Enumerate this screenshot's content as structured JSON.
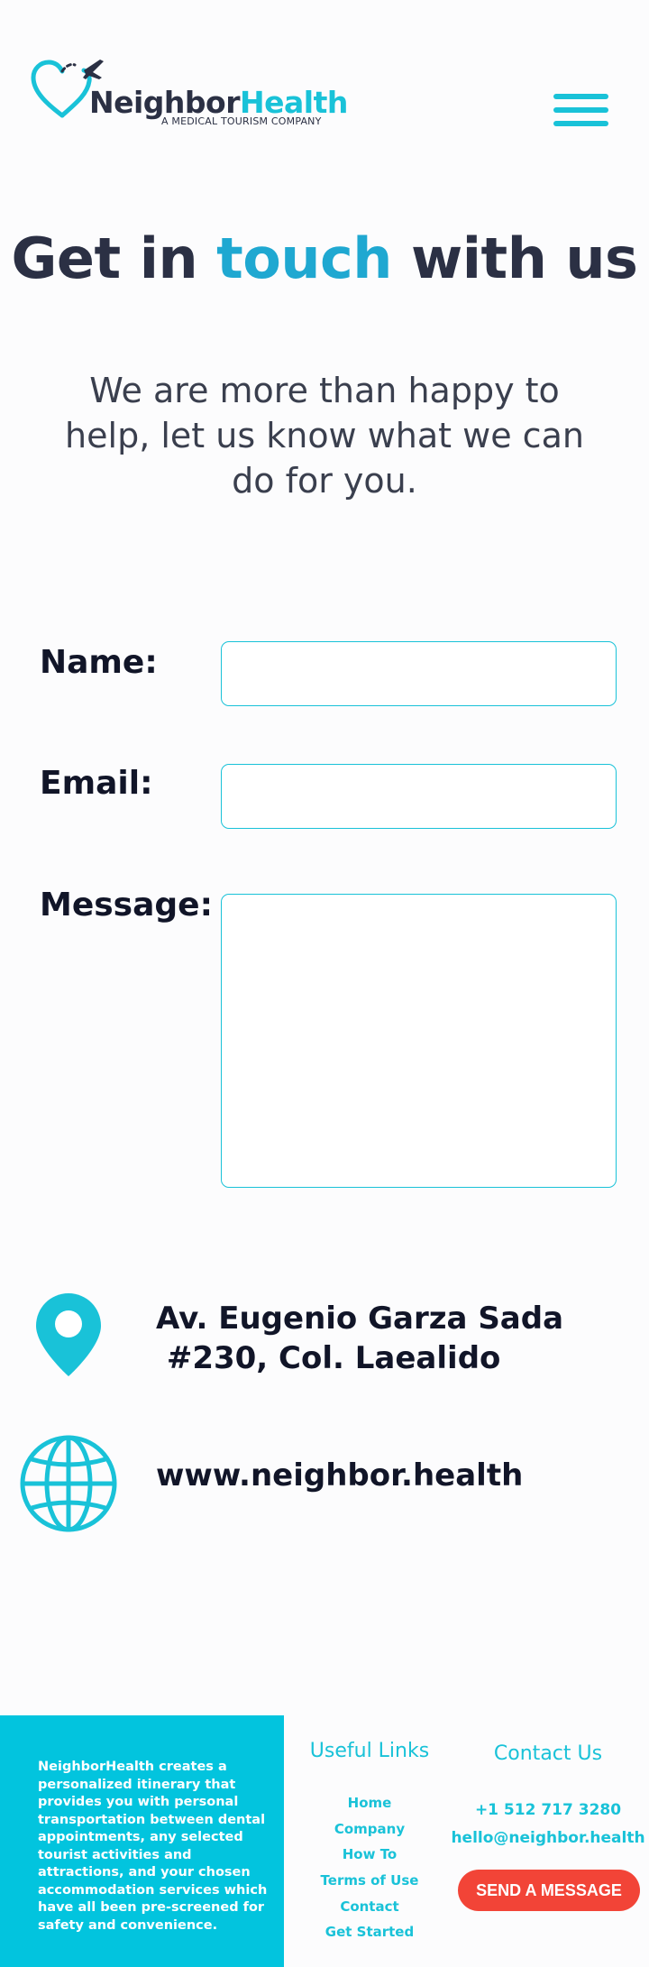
{
  "brand": {
    "name_part1": "Neighbor",
    "name_part2": "Health",
    "tagline": "A MEDICAL TOURISM COMPANY",
    "primary_color": "#19c2d8",
    "dark_color": "#2b3044",
    "cta_color": "#f24437"
  },
  "header": {
    "menu_icon": "hamburger-menu-icon"
  },
  "hero": {
    "title_part1": "Get in ",
    "title_accent": "touch",
    "title_part2": " with us",
    "subtitle": "We are more than happy to help, let us know what we can do for you."
  },
  "form": {
    "name_label": "Name:",
    "email_label": "Email:",
    "message_label": "Message:",
    "name_value": "",
    "email_value": "",
    "message_value": ""
  },
  "info": {
    "address_icon": "location-pin-icon",
    "address": "Av. Eugenio Garza Sada\n #230, Col. Laealido",
    "website_icon": "globe-icon",
    "website": "www.neighbor.health"
  },
  "footer": {
    "about": "NeighborHealth creates a personalized itinerary that provides you with personal transportation between dental appointments, any selected tourist activities and attractions, and your chosen accommodation services which have all been pre-screened for safety and convenience.",
    "links_title": "Useful Links",
    "links": [
      "Home",
      "Company",
      "How To",
      "Terms of Use",
      "Contact",
      "Get Started"
    ],
    "contact_title": "Contact Us",
    "phone": "+1 512 717 3280",
    "email": "hello@neighbor.health",
    "send_button": "SEND A MESSAGE"
  }
}
